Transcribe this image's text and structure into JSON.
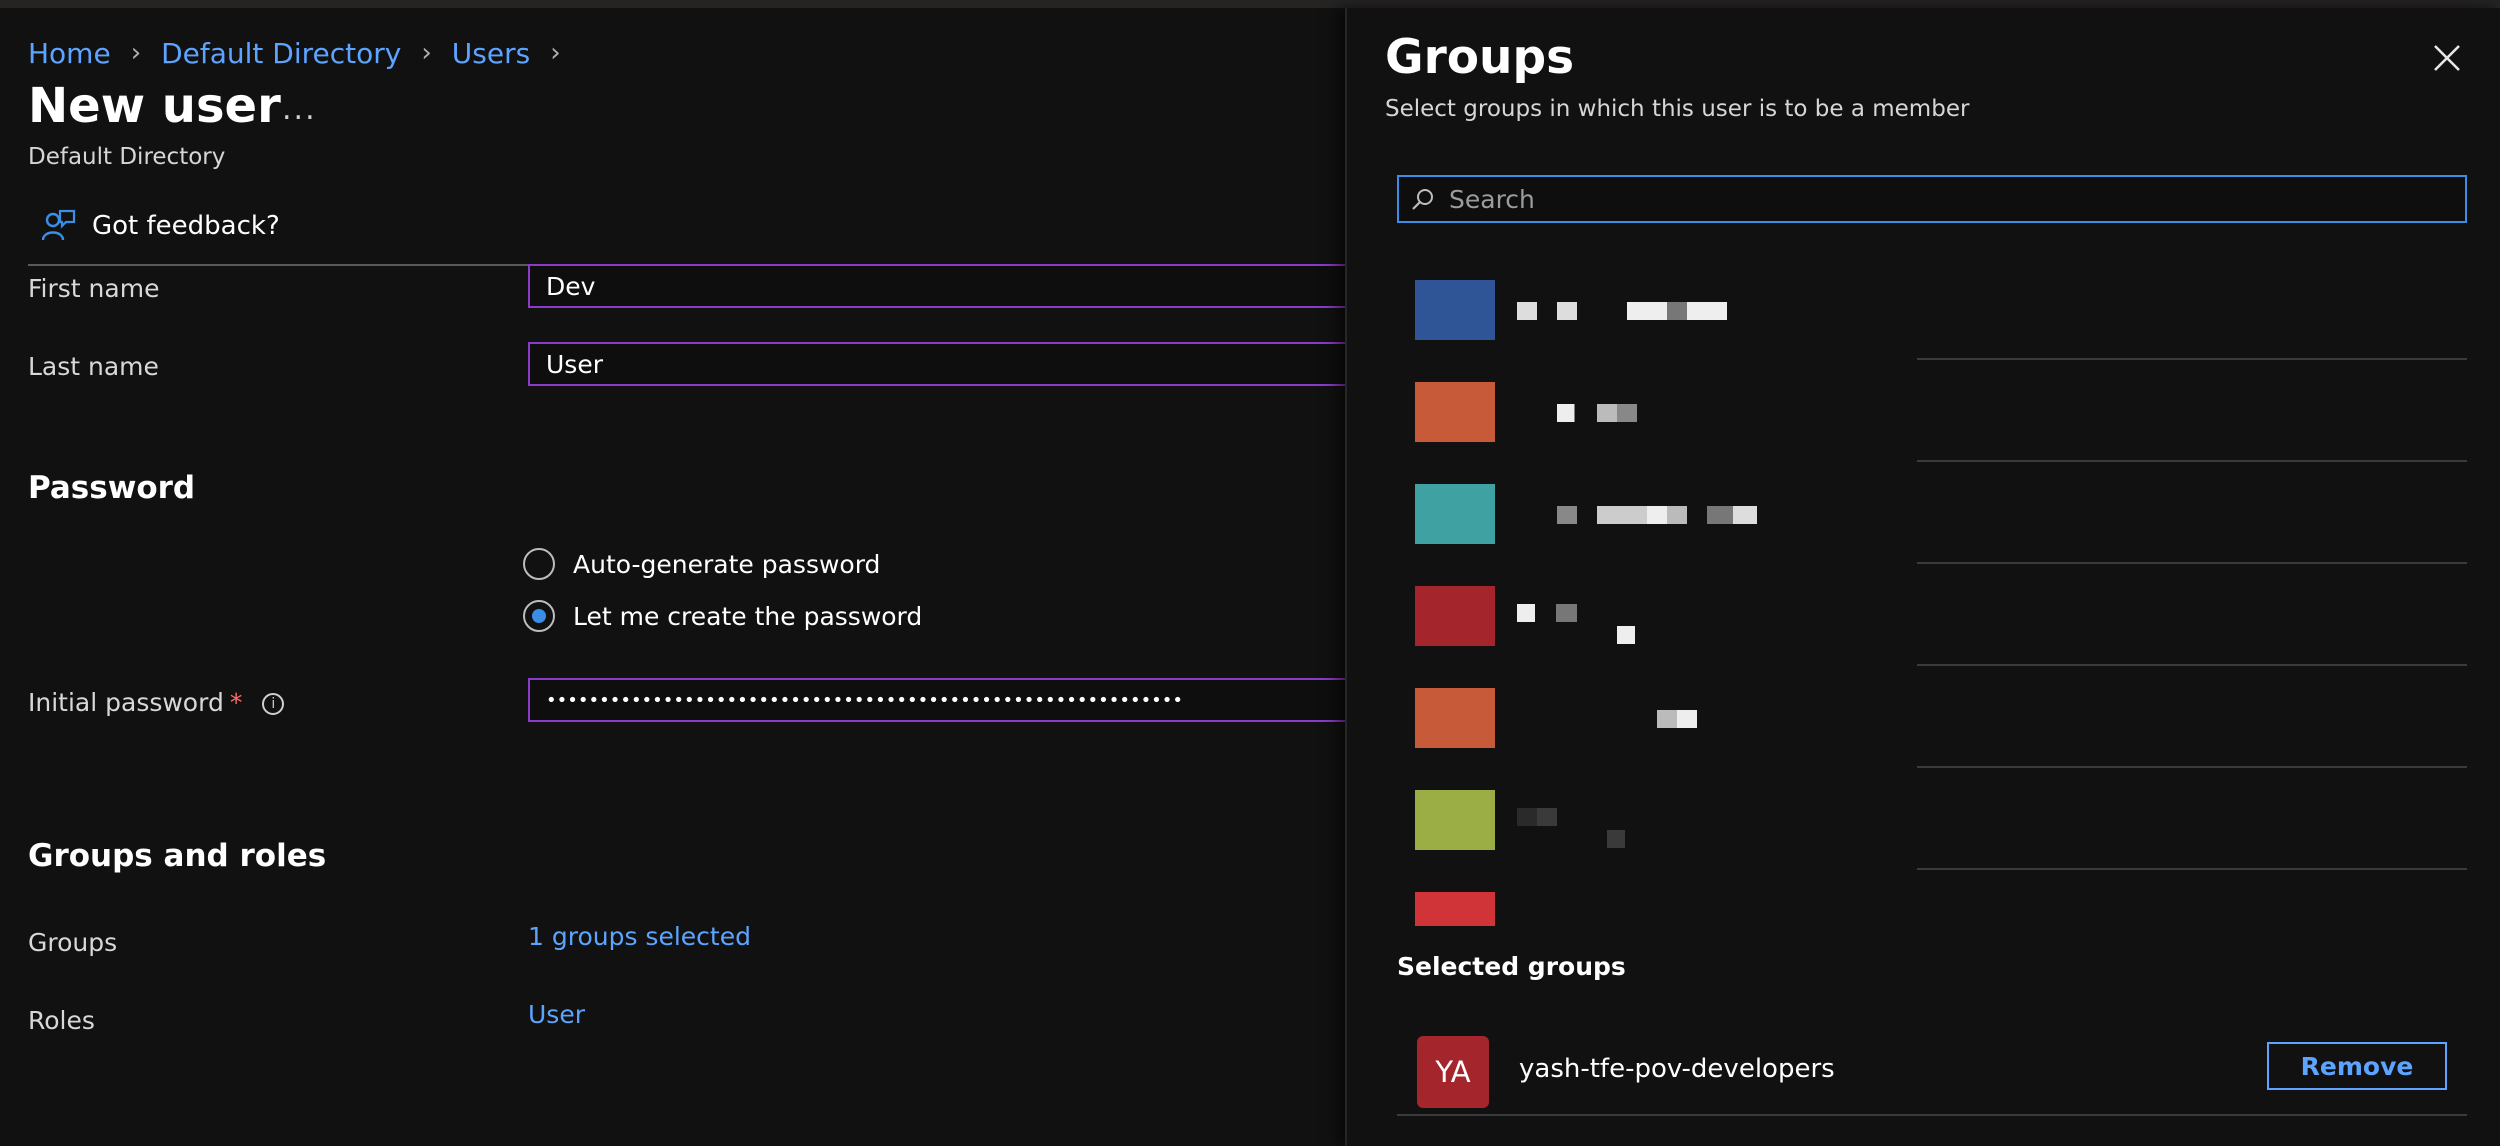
{
  "breadcrumb": {
    "items": [
      "Home",
      "Default Directory",
      "Users"
    ]
  },
  "page": {
    "title": "New user",
    "subtitle": "Default Directory",
    "more_label": "..."
  },
  "toolbar": {
    "feedback_label": "Got feedback?",
    "feedback_icon": "person-feedback-icon"
  },
  "identity": {
    "first_name_label": "First name",
    "first_name_value": "Dev",
    "last_name_label": "Last name",
    "last_name_value": "User"
  },
  "password": {
    "section_title": "Password",
    "auto_label": "Auto-generate password",
    "manual_label": "Let me create the password",
    "selected": "manual",
    "initial_label": "Initial password",
    "required_mark": "*",
    "initial_value": "••••••••••••••••••••••••••••••••••••••••••••••••••••••••••••"
  },
  "groups_roles": {
    "section_title": "Groups and roles",
    "groups_label": "Groups",
    "groups_value": "1 groups selected",
    "roles_label": "Roles",
    "roles_value": "User"
  },
  "panel": {
    "title": "Groups",
    "subtitle": "Select groups in which this user is to be a member",
    "search_placeholder": "Search",
    "group_colors": [
      "#2f5597",
      "#c75b39",
      "#3fa1a1",
      "#a4262c",
      "#c75b39",
      "#9aae45",
      "#d13438"
    ],
    "selected_title": "Selected groups",
    "selected": [
      {
        "initials": "YA",
        "name": "yash-tfe-pov-developers",
        "color": "#a4262c"
      }
    ],
    "remove_label": "Remove"
  }
}
